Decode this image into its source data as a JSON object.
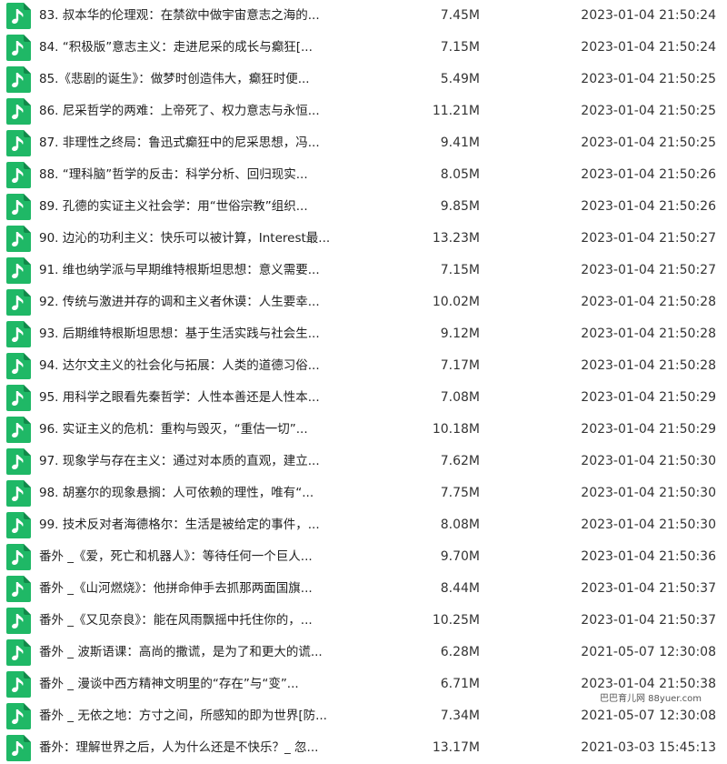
{
  "colors": {
    "icon_green": "#1fb866",
    "icon_note": "#ffffff"
  },
  "icon": "music-file-icon",
  "files": [
    {
      "name": "83. 叔本华的伦理观：在禁欲中做宇宙意志之海的...",
      "size": "7.45M",
      "date": "2023-01-04 21:50:24"
    },
    {
      "name": "84. “积极版”意志主义：走进尼采的成长与癫狂[...",
      "size": "7.15M",
      "date": "2023-01-04 21:50:24"
    },
    {
      "name": "85.《悲剧的诞生》：做梦时创造伟大，癫狂时便...",
      "size": "5.49M",
      "date": "2023-01-04 21:50:25"
    },
    {
      "name": "86. 尼采哲学的两难：上帝死了、权力意志与永恒...",
      "size": "11.21M",
      "date": "2023-01-04 21:50:25"
    },
    {
      "name": "87. 非理性之终局：鲁迅式癫狂中的尼采思想，冯...",
      "size": "9.41M",
      "date": "2023-01-04 21:50:25"
    },
    {
      "name": "88. “理科脑”哲学的反击：科学分析、回归现实...",
      "size": "8.05M",
      "date": "2023-01-04 21:50:26"
    },
    {
      "name": "89. 孔德的实证主义社会学：用“世俗宗教”组织...",
      "size": "9.85M",
      "date": "2023-01-04 21:50:26"
    },
    {
      "name": "90. 边沁的功利主义：快乐可以被计算，Interest最...",
      "size": "13.23M",
      "date": "2023-01-04 21:50:27"
    },
    {
      "name": "91. 维也纳学派与早期维特根斯坦思想：意义需要...",
      "size": "7.15M",
      "date": "2023-01-04 21:50:27"
    },
    {
      "name": "92. 传统与激进并存的调和主义者休谟：人生要幸...",
      "size": "10.02M",
      "date": "2023-01-04 21:50:28"
    },
    {
      "name": "93. 后期维特根斯坦思想：基于生活实践与社会生...",
      "size": "9.12M",
      "date": "2023-01-04 21:50:28"
    },
    {
      "name": "94. 达尔文主义的社会化与拓展：人类的道德习俗...",
      "size": "7.17M",
      "date": "2023-01-04 21:50:28"
    },
    {
      "name": "95. 用科学之眼看先秦哲学：人性本善还是人性本...",
      "size": "7.08M",
      "date": "2023-01-04 21:50:29"
    },
    {
      "name": "96. 实证主义的危机：重构与毁灭，“重估一切”...",
      "size": "10.18M",
      "date": "2023-01-04 21:50:29"
    },
    {
      "name": "97. 现象学与存在主义：通过对本质的直观，建立...",
      "size": "7.62M",
      "date": "2023-01-04 21:50:30"
    },
    {
      "name": "98. 胡塞尔的现象悬搁：人可依赖的理性，唯有“...",
      "size": "7.75M",
      "date": "2023-01-04 21:50:30"
    },
    {
      "name": "99. 技术反对者海德格尔：生活是被给定的事件，...",
      "size": "8.08M",
      "date": "2023-01-04 21:50:30"
    },
    {
      "name": "番外 _《爱，死亡和机器人》：等待任何一个巨人...",
      "size": "9.70M",
      "date": "2023-01-04 21:50:36"
    },
    {
      "name": "番外 _《山河燃烧》：他拼命伸手去抓那两面国旗...",
      "size": "8.44M",
      "date": "2023-01-04 21:50:37"
    },
    {
      "name": "番外 _《又见奈良》：能在风雨飘摇中托住你的，...",
      "size": "10.25M",
      "date": "2023-01-04 21:50:37"
    },
    {
      "name": "番外 _ 波斯语课：高尚的撒谎，是为了和更大的谎...",
      "size": "6.28M",
      "date": "2021-05-07 12:30:08"
    },
    {
      "name": "番外 _ 漫谈中西方精神文明里的“存在”与“变”...",
      "size": "6.71M",
      "date": "2023-01-04 21:50:38"
    },
    {
      "name": "番外 _ 无依之地：方寸之间，所感知的即为世界[防...",
      "size": "7.34M",
      "date": "2021-05-07 12:30:08"
    },
    {
      "name": "番外：理解世界之后，人为什么还是不快乐？_ 忽...",
      "size": "13.17M",
      "date": "2021-03-03 15:45:13"
    }
  ],
  "watermark": "巴巴育儿网 88yuer.com"
}
